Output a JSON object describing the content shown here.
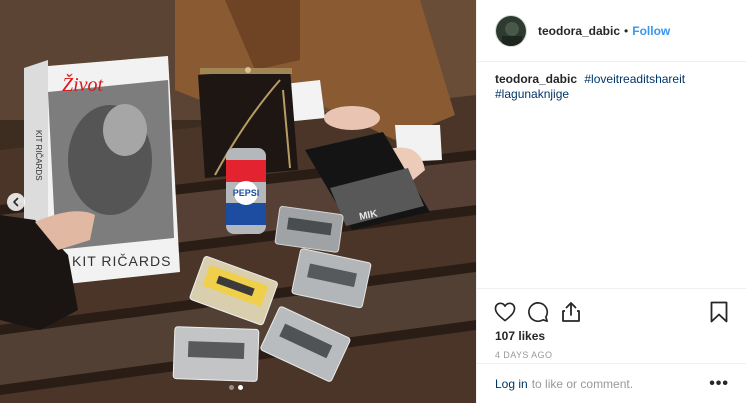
{
  "post": {
    "username": "teodora_dabic",
    "follow_label": "Follow",
    "bullet": "•",
    "caption": {
      "author": "teodora_dabic",
      "hashtags": [
        "#loveitreaditshareit",
        "#lagunaknjige"
      ]
    },
    "likes": "107 likes",
    "timestamp": "4 DAYS AGO",
    "login_link": "Log in",
    "login_rest": "to like or comment.",
    "more_label": "•••"
  },
  "photo": {
    "book_title": "Život",
    "book_author": "KIT RIČARDS",
    "book_spine": "KIT RIČARDS",
    "can_label": "PEPSI",
    "dvd_title": "MIK",
    "carousel": {
      "count": 2,
      "active": 2
    }
  },
  "colors": {
    "link": "#3897f0",
    "hashtag": "#003569",
    "muted": "#999999",
    "border": "#efefef"
  },
  "icons": [
    "chevron-left-icon",
    "heart-icon",
    "comment-icon",
    "share-icon",
    "bookmark-icon"
  ]
}
